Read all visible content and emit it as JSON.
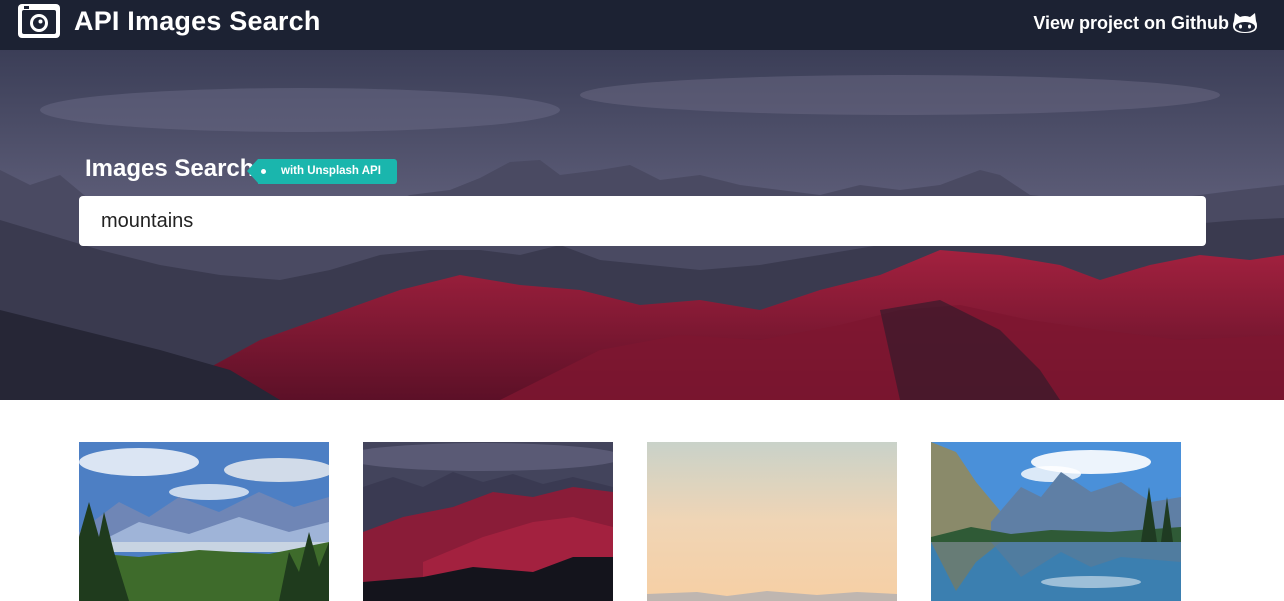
{
  "navbar": {
    "brand": "API Images Search",
    "github_link": "View project on Github",
    "logo_icon": "camera-icon",
    "github_icon": "github-octocat-icon",
    "background": "#1c2233"
  },
  "hero": {
    "title": "Images Search",
    "tag": "with Unsplash API",
    "tag_color": "#1ab6ad",
    "search_value": "mountains"
  },
  "results": [
    {
      "name": "result-image-1",
      "alt": "mountain valley with pine forest"
    },
    {
      "name": "result-image-2",
      "alt": "dark red mountain peaks"
    },
    {
      "name": "result-image-3",
      "alt": "hazy peach sky"
    },
    {
      "name": "result-image-4",
      "alt": "lake reflecting mountains"
    }
  ]
}
